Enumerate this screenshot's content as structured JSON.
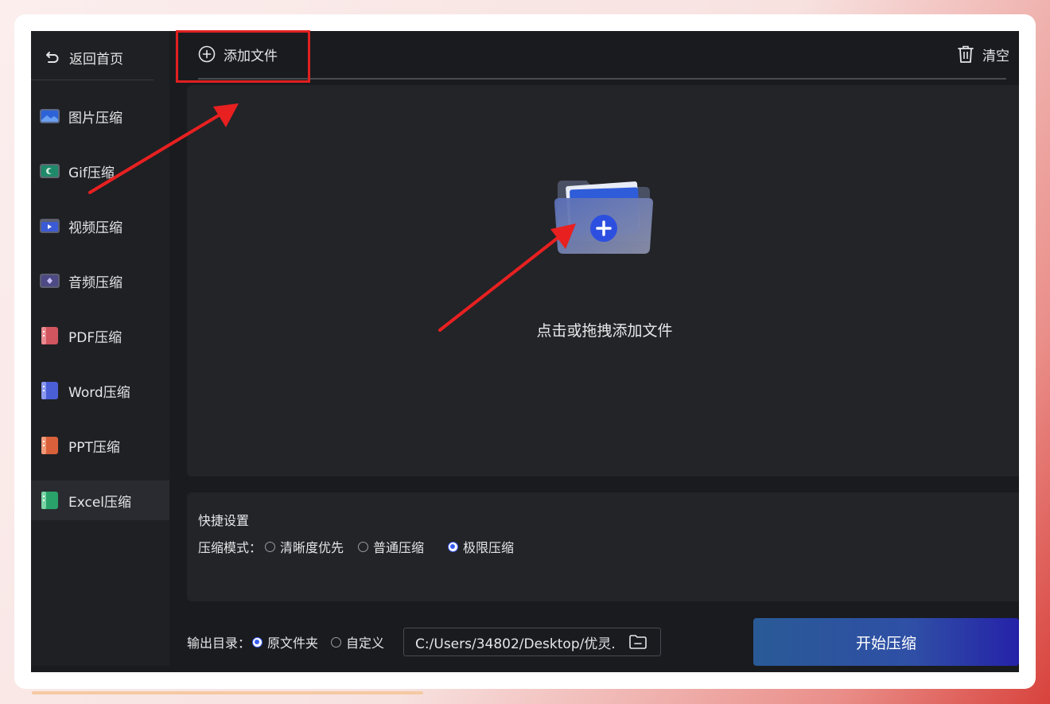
{
  "sidebar": {
    "back_label": "返回首页",
    "items": [
      {
        "label": "图片压缩",
        "icon": "image-icon",
        "color": "#3a6fd8"
      },
      {
        "label": "Gif压缩",
        "icon": "gif-icon",
        "color": "#2aa37a"
      },
      {
        "label": "视频压缩",
        "icon": "video-icon",
        "color": "#3b5bd6"
      },
      {
        "label": "音频压缩",
        "icon": "audio-icon",
        "color": "#6a58d0"
      },
      {
        "label": "PDF压缩",
        "icon": "pdf-icon",
        "color": "#d0555e"
      },
      {
        "label": "Word压缩",
        "icon": "word-icon",
        "color": "#4a5ed6"
      },
      {
        "label": "PPT压缩",
        "icon": "ppt-icon",
        "color": "#d8603a"
      },
      {
        "label": "Excel压缩",
        "icon": "excel-icon",
        "color": "#2aa36a",
        "active": true
      }
    ]
  },
  "toolbar": {
    "add_file_label": "添加文件",
    "clear_label": "清空"
  },
  "dropzone": {
    "label": "点击或拖拽添加文件"
  },
  "settings": {
    "title": "快捷设置",
    "mode_label": "压缩模式：",
    "modes": [
      {
        "label": "清晰度优先",
        "checked": false
      },
      {
        "label": "普通压缩",
        "checked": false
      },
      {
        "label": "极限压缩",
        "checked": true
      }
    ]
  },
  "output": {
    "label": "输出目录：",
    "options": [
      {
        "label": "原文件夹",
        "checked": true
      },
      {
        "label": "自定义",
        "checked": false
      }
    ],
    "path": "C:/Users/34802/Desktop/优灵."
  },
  "start_label": "开始压缩",
  "colors": {
    "accent": "#3a5df0",
    "annotation": "#e02020"
  }
}
